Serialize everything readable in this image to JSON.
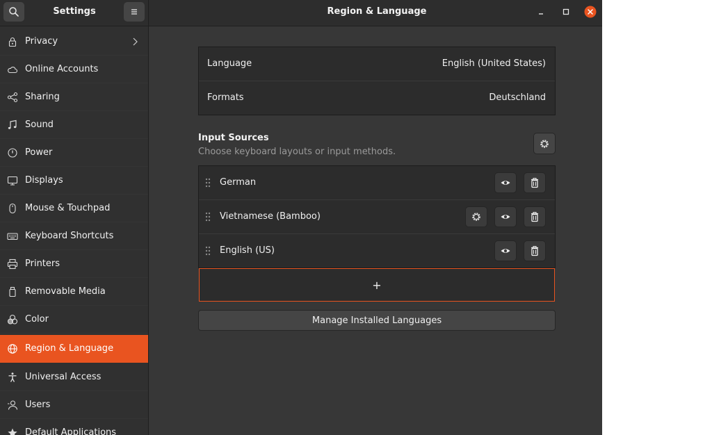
{
  "header": {
    "sidebar_title": "Settings",
    "title": "Region & Language",
    "search_icon": "search-icon",
    "menu_icon": "hamburger-menu-icon"
  },
  "colors": {
    "accent": "#e95420",
    "background": "#373737",
    "sidebar": "#303030",
    "headerbar": "#2d2d2d"
  },
  "sidebar": {
    "items": [
      {
        "label": "Privacy",
        "icon": "lock-icon"
      },
      {
        "label": "Online Accounts",
        "icon": "cloud-icon"
      },
      {
        "label": "Sharing",
        "icon": "share-icon"
      },
      {
        "label": "Sound",
        "icon": "music-note-icon"
      },
      {
        "label": "Power",
        "icon": "power-icon"
      },
      {
        "label": "Displays",
        "icon": "display-icon"
      },
      {
        "label": "Mouse & Touchpad",
        "icon": "mouse-icon"
      },
      {
        "label": "Keyboard Shortcuts",
        "icon": "keyboard-icon"
      },
      {
        "label": "Printers",
        "icon": "printer-icon"
      },
      {
        "label": "Removable Media",
        "icon": "usb-drive-icon"
      },
      {
        "label": "Color",
        "icon": "color-icon"
      },
      {
        "label": "Region & Language",
        "icon": "globe-icon",
        "active": true
      },
      {
        "label": "Universal Access",
        "icon": "accessibility-icon"
      },
      {
        "label": "Users",
        "icon": "users-icon"
      },
      {
        "label": "Default Applications",
        "icon": "star-icon"
      }
    ]
  },
  "settings": {
    "language_label": "Language",
    "language_value": "English (United States)",
    "formats_label": "Formats",
    "formats_value": "Deutschland"
  },
  "input_sources": {
    "title": "Input Sources",
    "subtitle": "Choose keyboard layouts or input methods.",
    "items": [
      {
        "label": "German",
        "has_settings": false
      },
      {
        "label": "Vietnamese (Bamboo)",
        "has_settings": true
      },
      {
        "label": "English (US)",
        "has_settings": false
      }
    ],
    "add_label": "+"
  },
  "manage_label": "Manage Installed Languages"
}
